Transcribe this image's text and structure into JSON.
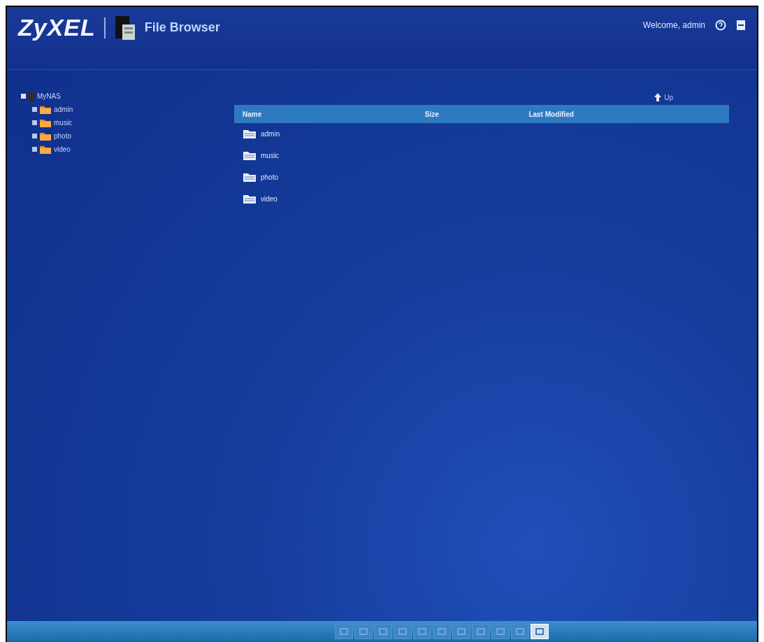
{
  "header": {
    "logo": "ZyXEL",
    "title": "File Browser",
    "welcome": "Welcome, admin"
  },
  "tree": {
    "label": "MyNAS",
    "expanded": true,
    "children": [
      {
        "label": "admin",
        "expanded": false
      },
      {
        "label": "music",
        "expanded": false
      },
      {
        "label": "photo",
        "expanded": false
      },
      {
        "label": "video",
        "expanded": false
      }
    ]
  },
  "up_link": "Up",
  "table": {
    "columns": [
      "Name",
      "Size",
      "Last Modified"
    ],
    "rows": [
      {
        "name": "admin"
      },
      {
        "name": "music"
      },
      {
        "name": "photo"
      },
      {
        "name": "video"
      }
    ]
  },
  "toolbar": {
    "buttons": [
      {
        "selected": false
      },
      {
        "selected": false
      },
      {
        "selected": false
      },
      {
        "selected": false
      },
      {
        "selected": false
      },
      {
        "selected": false
      },
      {
        "selected": false
      },
      {
        "selected": false
      },
      {
        "selected": false
      },
      {
        "selected": false
      },
      {
        "selected": true
      }
    ]
  }
}
